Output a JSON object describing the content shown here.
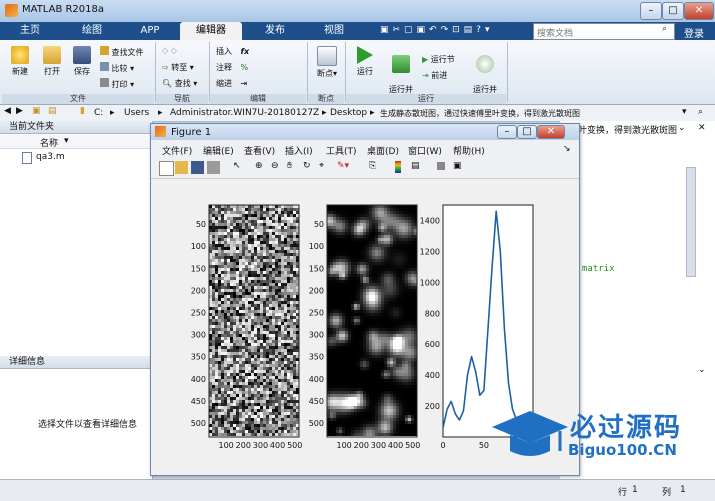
{
  "window": {
    "title": "MATLAB R2018a",
    "min": "–",
    "max": "□",
    "close": "✕"
  },
  "tabs": [
    {
      "label": "主页",
      "active": false
    },
    {
      "label": "绘图",
      "active": false
    },
    {
      "label": "APP",
      "active": false
    },
    {
      "label": "编辑器",
      "active": true
    },
    {
      "label": "发布",
      "active": false
    },
    {
      "label": "视图",
      "active": false
    }
  ],
  "search": {
    "placeholder": "搜索文档",
    "login": "登录"
  },
  "ribbon": {
    "file": {
      "new": "新建",
      "open": "打开",
      "save": "保存",
      "find_files": "查找文件",
      "compare": "比较",
      "print": "打印",
      "group": "文件"
    },
    "nav": {
      "goto": "转至",
      "find": "查找",
      "group": "导航"
    },
    "edit": {
      "insert": "插入",
      "comment": "注释",
      "indent": "缩进",
      "fx": "fx",
      "group": "编辑"
    },
    "breakpoints": {
      "label": "断点",
      "group": "断点"
    },
    "run": {
      "run": "运行",
      "run_advance": "运行并\n前进",
      "run_section": "运行节",
      "advance": "前进",
      "run_time": "运行并\n计时",
      "group": "运行"
    }
  },
  "address": {
    "path": [
      "C:",
      "Users",
      "Administrator.WIN7U-20180127Z",
      "Desktop",
      "生成静态散斑图，通过快速傅里叶变换，得到激光散斑图"
    ]
  },
  "current_folder": {
    "title": "当前文件夹",
    "column": "名称",
    "files": [
      "qa3.m"
    ]
  },
  "details": {
    "title": "详细信息",
    "empty_msg": "选择文件以查看详细信息"
  },
  "editor_bg_text": {
    "partial_title": "叶变换，得到激光散斑图",
    "code": "matrix"
  },
  "status": {
    "row_label": "行",
    "row": "1",
    "col_label": "列",
    "col": "1"
  },
  "figure": {
    "title": "Figure 1",
    "menu": [
      "文件(F)",
      "编辑(E)",
      "查看(V)",
      "插入(I)",
      "工具(T)",
      "桌面(D)",
      "窗口(W)",
      "帮助(H)"
    ]
  },
  "chart_data": [
    {
      "type": "heatmap",
      "description_kind": "random noise image",
      "x_ticks": [
        100,
        200,
        300,
        400,
        500
      ],
      "y_ticks": [
        50,
        100,
        150,
        200,
        250,
        300,
        350,
        400,
        450,
        500
      ],
      "colormap": "gray"
    },
    {
      "type": "heatmap",
      "description_kind": "speckle pattern",
      "x_ticks": [
        100,
        200,
        300,
        400,
        500
      ],
      "y_ticks": [
        50,
        100,
        150,
        200,
        250,
        300,
        350,
        400,
        450,
        500
      ],
      "colormap": "gray"
    },
    {
      "type": "line",
      "x": [
        0,
        5,
        10,
        15,
        20,
        25,
        30,
        35,
        40,
        45,
        50,
        55,
        60,
        65,
        70,
        75,
        80,
        85,
        90,
        95,
        100
      ],
      "y": [
        60,
        180,
        230,
        150,
        110,
        170,
        400,
        520,
        420,
        270,
        300,
        700,
        1100,
        1460,
        1200,
        700,
        350,
        180,
        110,
        80,
        60
      ],
      "x_ticks": [
        0,
        50,
        100
      ],
      "y_ticks": [
        200,
        400,
        600,
        800,
        1000,
        1200,
        1400
      ],
      "xlim": [
        0,
        110
      ],
      "ylim": [
        0,
        1500
      ],
      "color": "#1f5fa8"
    }
  ],
  "watermark": {
    "text1": "必过源码",
    "text2": "Biguo100.CN"
  }
}
